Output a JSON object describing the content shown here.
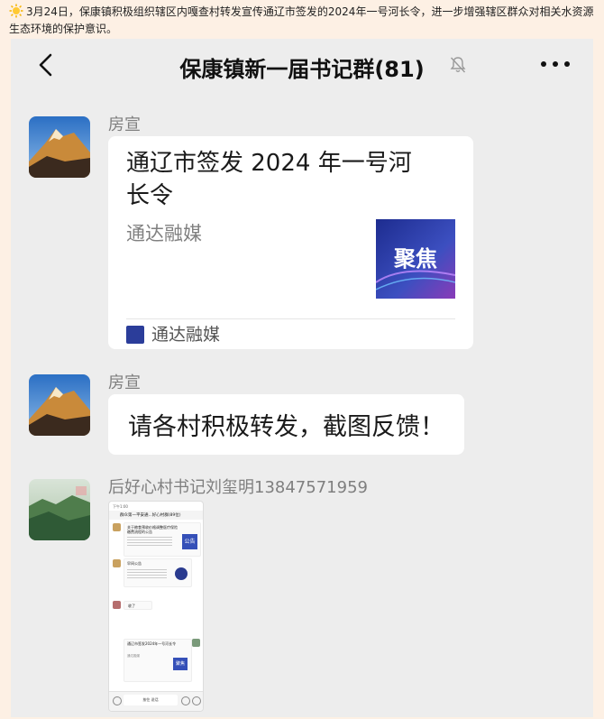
{
  "caption": {
    "text": "3月24日，保康镇积极组织辖区内嘎查村转发宣传通辽市签发的2024年一号河长令，进一步增强辖区群众对相关水资源生态环境的保护意识。"
  },
  "chat": {
    "title": "保康镇新一届书记群(81)",
    "icons": {
      "back": "back-icon",
      "mute": "mute-bell-icon",
      "more": "more-icon"
    }
  },
  "messages": [
    {
      "sender": "房宣",
      "type": "link-card",
      "card": {
        "title": "通辽市签发 2024 年一号河长令",
        "description": "通达融媒",
        "thumbnail_text": "聚焦",
        "source": "通达融媒"
      }
    },
    {
      "sender": "房宣",
      "type": "text",
      "text": "请各村积极转发，截图反馈！"
    },
    {
      "sender": "后好心村书记刘玺明13847571959",
      "type": "image",
      "screenshot": {
        "status_bar": "下午1:00",
        "header": "群众第一平安通...好心村群(89位)",
        "msg1_title": "关于粮食预收价格调整医疗保险缴费流程的公告",
        "msg1_thumb": "公告",
        "msg2_title": "早间公告",
        "reply": "收了",
        "card_title": "通辽市签发2024年一号河长令",
        "card_source": "通达融媒",
        "card_thumb": "聚焦",
        "input_hint": "按住 说话"
      }
    }
  ],
  "colors": {
    "chat_bg": "#ededed",
    "page_bg": "#fdf0e4",
    "bubble": "#ffffff",
    "thumbnail_blue": "#2b3d9a"
  }
}
